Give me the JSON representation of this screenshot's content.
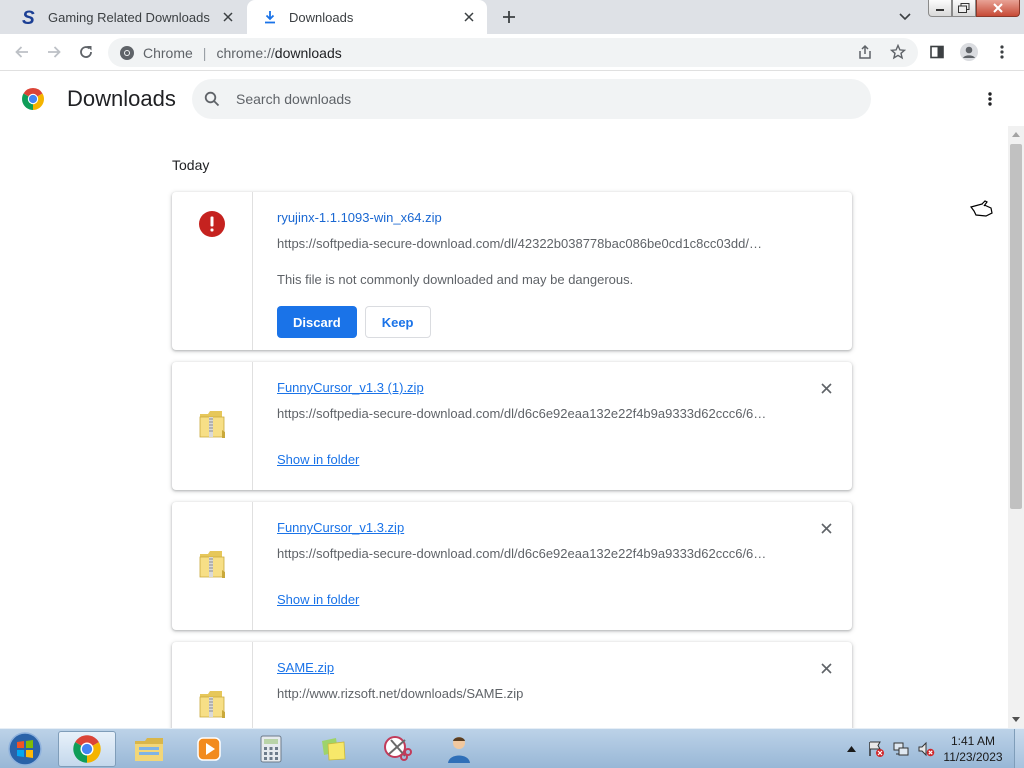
{
  "tabs": [
    {
      "title": "Gaming Related Downloads",
      "favicon": "softpedia-s-icon",
      "active": false
    },
    {
      "title": "Downloads",
      "favicon": "download-icon",
      "active": true
    }
  ],
  "toolbar": {
    "omnibox_origin": "Chrome",
    "omnibox_separator": "|",
    "omnibox_scheme": "chrome://",
    "omnibox_path": "downloads"
  },
  "header": {
    "title": "Downloads",
    "search_placeholder": "Search downloads"
  },
  "date_group": "Today",
  "downloads": [
    {
      "name": "ryujinx-1.1.1093-win_x64.zip",
      "url": "https://softpedia-secure-download.com/dl/42322b038778bac086be0cd1c8cc03dd/…",
      "status": "dangerous",
      "warning": "This file is not commonly downloaded and may be dangerous.",
      "discard_label": "Discard",
      "keep_label": "Keep"
    },
    {
      "name": "FunnyCursor_v1.3 (1).zip",
      "url": "https://softpedia-secure-download.com/dl/d6c6e92eaa132e22f4b9a9333d62ccc6/6…",
      "status": "complete",
      "action_label": "Show in folder"
    },
    {
      "name": "FunnyCursor_v1.3.zip",
      "url": "https://softpedia-secure-download.com/dl/d6c6e92eaa132e22f4b9a9333d62ccc6/6…",
      "status": "complete",
      "action_label": "Show in folder"
    },
    {
      "name": "SAME.zip",
      "url": "http://www.rizsoft.net/downloads/SAME.zip",
      "status": "complete"
    }
  ],
  "taskbar": {
    "time": "1:41 AM",
    "date": "11/23/2023"
  },
  "colors": {
    "accent": "#1a73e8",
    "danger": "#c5221f",
    "tabstrip": "#dee1e6"
  }
}
